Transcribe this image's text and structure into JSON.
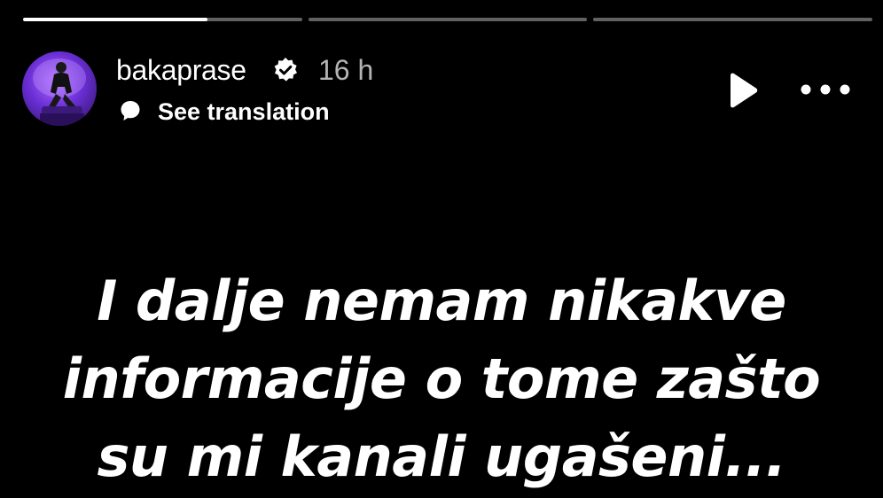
{
  "progress": {
    "segments": [
      {
        "fill": 0.66
      },
      {
        "fill": 0
      },
      {
        "fill": 0
      }
    ]
  },
  "header": {
    "username": "bakaprase",
    "time": "16 h",
    "translation_label": "See translation"
  },
  "story": {
    "lines": [
      "I dalje nemam nikakve",
      "informacije o tome zašto",
      "su mi kanali ugašeni..."
    ]
  },
  "icons": {
    "verified": "verified-badge-icon",
    "translate": "speech-bubble-icon",
    "play": "play-icon",
    "more": "more-options-icon"
  },
  "colors": {
    "background": "#000000",
    "text": "#ffffff",
    "secondary_text": "#b3b3b3",
    "progress_track": "rgba(255,255,255,0.38)",
    "avatar_bg": "#6b2fd6"
  }
}
